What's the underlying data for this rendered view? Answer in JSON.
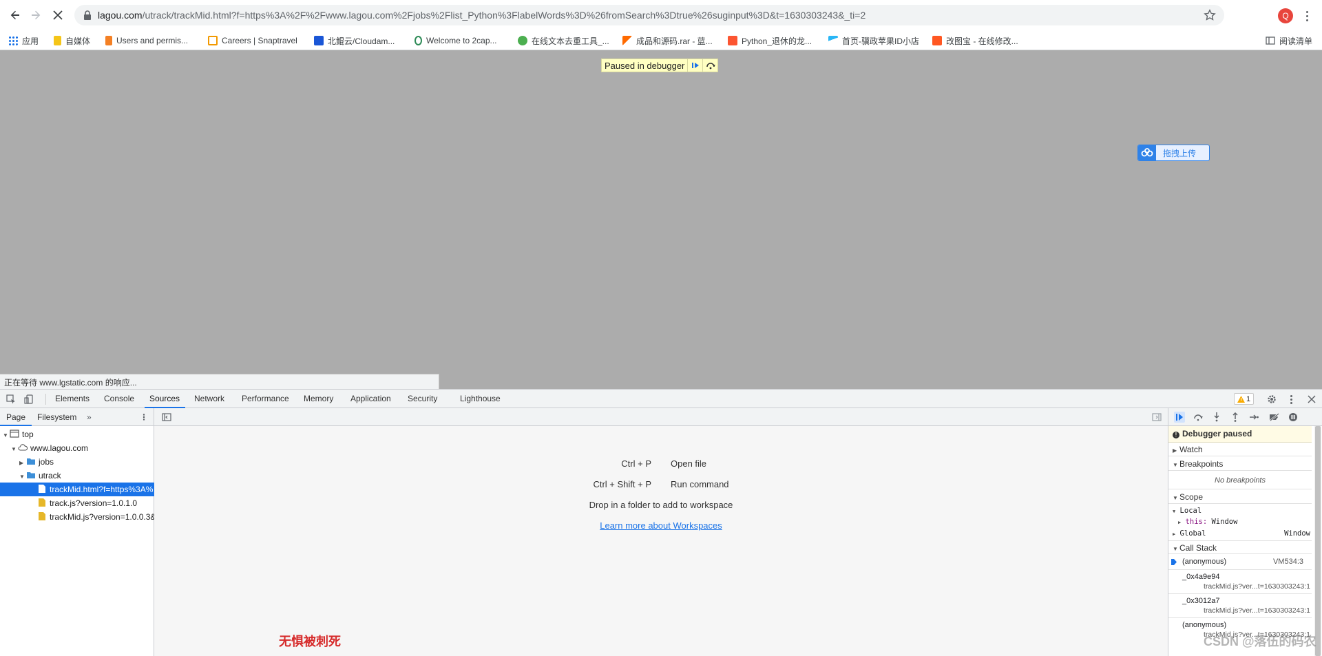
{
  "browser": {
    "url_host": "lagou.com",
    "url_path": "/utrack/trackMid.html?f=https%3A%2F%2Fwww.lagou.com%2Fjobs%2Flist_Python%3FlabelWords%3D%26fromSearch%3Dtrue%26suginput%3D&t=1630303243&_ti=2",
    "profile_initial": "Q",
    "bookmarks": [
      {
        "label": "应用",
        "icon": "apps-grid-icon",
        "color": "#1a73e8"
      },
      {
        "label": "自媒体",
        "icon": "folder-icon",
        "color": "#f5c518"
      },
      {
        "label": "Users and permis...",
        "icon": "stackoverflow-icon",
        "color": "#f48024"
      },
      {
        "label": "Careers | Snaptravel",
        "icon": "snaptravel-icon",
        "color": "#f29900"
      },
      {
        "label": "北鲲云/Cloudam...",
        "icon": "cloudam-icon",
        "color": "#1a56d6"
      },
      {
        "label": "Welcome to 2cap...",
        "icon": "2captcha-icon",
        "color": "#2e8b57"
      },
      {
        "label": "在线文本去重工具_...",
        "icon": "frog-icon",
        "color": "#4caf50"
      },
      {
        "label": "成品和源码.rar - 蓝...",
        "icon": "lanzou-icon",
        "color": "#ff6a00"
      },
      {
        "label": "Python_退休的龙...",
        "icon": "csdn-icon",
        "color": "#fc5531"
      },
      {
        "label": "首页-骥政苹果ID小店",
        "icon": "bird-icon",
        "color": "#29b6f6"
      },
      {
        "label": "改图宝 - 在线修改...",
        "icon": "gaitubao-icon",
        "color": "#ff5722"
      }
    ],
    "reading_list": "阅读清单"
  },
  "page": {
    "paused_label": "Paused in debugger",
    "upload_widget_label": "拖拽上传",
    "status_text": "正在等待 www.lgstatic.com 的响应..."
  },
  "devtools": {
    "tabs": [
      "Elements",
      "Console",
      "Sources",
      "Network",
      "Performance",
      "Memory",
      "Application",
      "Security",
      "Lighthouse"
    ],
    "active_tab": "Sources",
    "warning_count": "1",
    "navigator_tabs": [
      "Page",
      "Filesystem"
    ],
    "tree": {
      "top": "top",
      "domain": "www.lagou.com",
      "folder_jobs": "jobs",
      "folder_utrack": "utrack",
      "file_selected": "trackMid.html?f=https%3A%",
      "file_track": "track.js?version=1.0.1.0",
      "file_trackmid": "trackMid.js?version=1.0.0.3&"
    },
    "editor": {
      "open_file_key": "Ctrl + P",
      "open_file_label": "Open file",
      "run_command_key": "Ctrl + Shift + P",
      "run_command_label": "Run command",
      "drop_text": "Drop in a folder to add to workspace",
      "learn_more": "Learn more about Workspaces",
      "overlay_text": "无惧被刺死"
    },
    "debugger": {
      "paused": "Debugger paused",
      "watch": "Watch",
      "breakpoints": "Breakpoints",
      "no_breakpoints": "No breakpoints",
      "scope": "Scope",
      "local": "Local",
      "this_key": "this:",
      "this_val": "Window",
      "global": "Global",
      "global_val": "Window",
      "call_stack": "Call Stack",
      "frames": [
        {
          "fn": "(anonymous)",
          "loc": "VM534:3"
        },
        {
          "fn": "_0x4a9e94",
          "loc": "trackMid.js?ver...t=1630303243:1"
        },
        {
          "fn": "_0x3012a7",
          "loc": "trackMid.js?ver...t=1630303243:1"
        },
        {
          "fn": "(anonymous)",
          "loc": "trackMid.js?ver...t=1630303243:1"
        }
      ]
    },
    "watermark": "CSDN @落伍的码农"
  }
}
